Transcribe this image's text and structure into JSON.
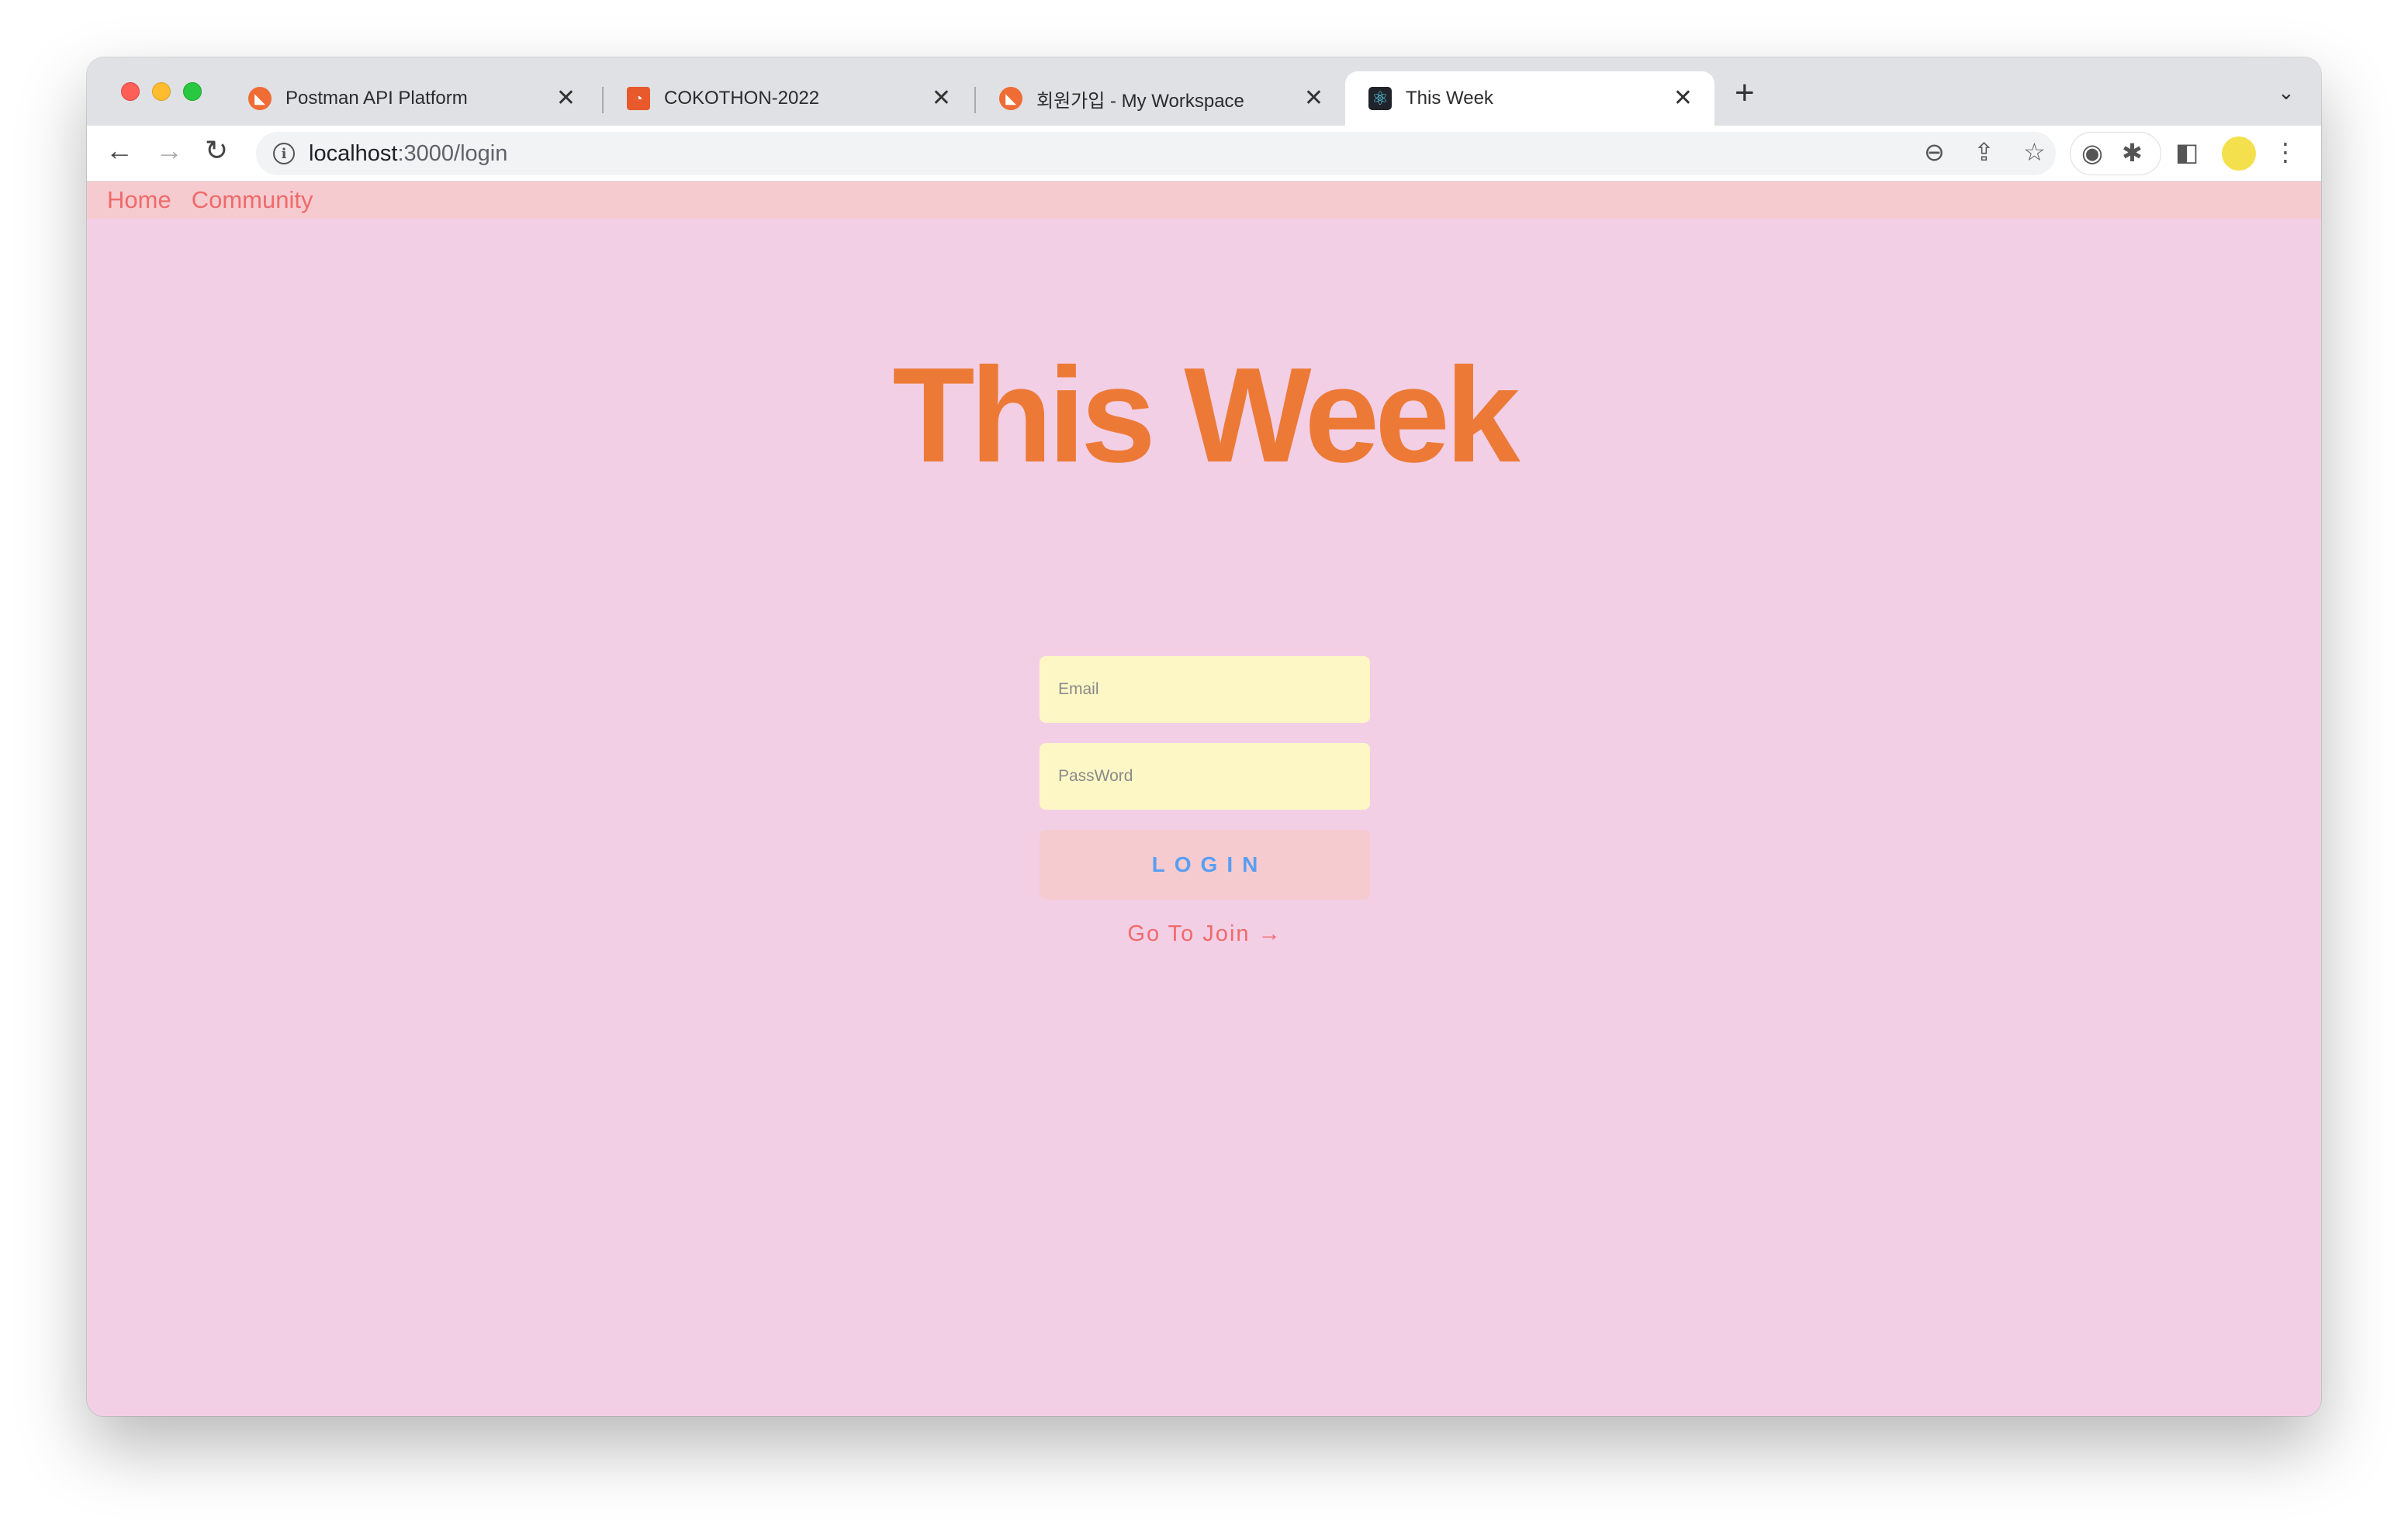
{
  "browser": {
    "tabs": [
      {
        "label": "Postman API Platform",
        "favicon": "postman-icon",
        "close": "✕",
        "active": false
      },
      {
        "label": "COKOTHON-2022",
        "favicon": "square-logo-icon",
        "close": "✕",
        "active": false
      },
      {
        "label": "회원가입 - My Workspace",
        "favicon": "postman-icon",
        "close": "✕",
        "active": false
      },
      {
        "label": "This Week",
        "favicon": "react-icon",
        "close": "✕",
        "active": true
      }
    ],
    "new_tab": "+",
    "tab_list": "⌄",
    "address": {
      "host": "localhost",
      "path": ":3000/login"
    },
    "icons": {
      "back": "←",
      "forward": "→",
      "reload": "↻",
      "info": "i",
      "zoom": "⊖",
      "share": "⇪",
      "bookmark": "☆",
      "screenshot": "◉",
      "extensions": "✱",
      "sidepanel": "◧",
      "menu": "⋮"
    },
    "colors": {
      "close": "#ff5f57",
      "minimize": "#febc2e",
      "maximize": "#28c840"
    }
  },
  "nav": {
    "home": "Home",
    "community": "Community"
  },
  "hero": {
    "title": "This Week"
  },
  "login_form": {
    "email_placeholder": "Email",
    "password_placeholder": "PassWord",
    "login_label": "LOGIN",
    "join_link": "Go To Join →"
  },
  "theme": {
    "background": "#f3cfe6",
    "nav_background": "#f5cbcf",
    "title_color": "#ec7a36",
    "input_background": "#fdf7c6",
    "button_background": "#f5cbcf",
    "button_text": "#5a9ef2",
    "link_color": "#ef6a6a"
  }
}
